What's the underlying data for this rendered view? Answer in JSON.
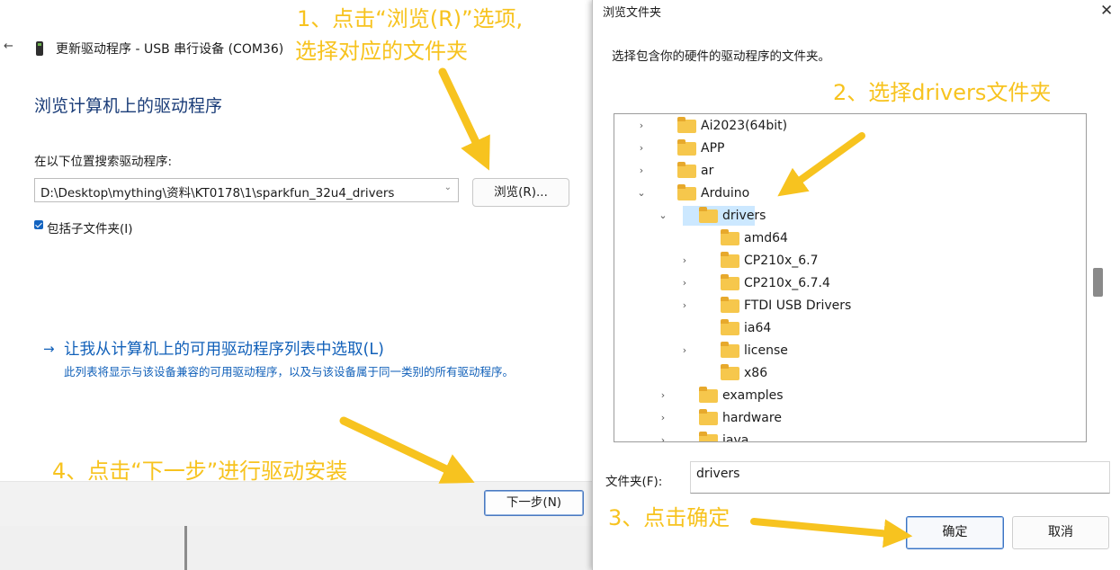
{
  "left_window": {
    "back_icon": "back-arrow-icon",
    "title": "更新驱动程序 - USB 串行设备 (COM36)",
    "heading": "浏览计算机上的驱动程序",
    "search_label": "在以下位置搜索驱动程序:",
    "path_value": "D:\\Desktop\\mything\\资料\\KT0178\\1\\sparkfun_32u4_drivers",
    "browse_label": "浏览(R)...",
    "include_subfolders_label": "包括子文件夹(I)",
    "include_subfolders_checked": true,
    "pick_link": "让我从计算机上的可用驱动程序列表中选取(L)",
    "pick_desc": "此列表将显示与该设备兼容的可用驱动程序，以及与该设备属于同一类别的所有驱动程序。",
    "next_label": "下一步(N)"
  },
  "dialog": {
    "title": "浏览文件夹",
    "close_icon": "close-icon",
    "instruction": "选择包含你的硬件的驱动程序的文件夹。",
    "tree": [
      {
        "label": "Ai2023(64bit)",
        "level": 0,
        "chevron": "›"
      },
      {
        "label": "APP",
        "level": 0,
        "chevron": "›"
      },
      {
        "label": "ar",
        "level": 0,
        "chevron": "›"
      },
      {
        "label": "Arduino",
        "level": 0,
        "chevron": "⌄"
      },
      {
        "label": "drivers",
        "level": 1,
        "chevron": "⌄",
        "selected": true
      },
      {
        "label": "amd64",
        "level": 2,
        "chevron": ""
      },
      {
        "label": "CP210x_6.7",
        "level": 2,
        "chevron": "›"
      },
      {
        "label": "CP210x_6.7.4",
        "level": 2,
        "chevron": "›"
      },
      {
        "label": "FTDI USB Drivers",
        "level": 2,
        "chevron": "›"
      },
      {
        "label": "ia64",
        "level": 2,
        "chevron": ""
      },
      {
        "label": "license",
        "level": 2,
        "chevron": "›"
      },
      {
        "label": "x86",
        "level": 2,
        "chevron": ""
      },
      {
        "label": "examples",
        "level": 1,
        "chevron": "›"
      },
      {
        "label": "hardware",
        "level": 1,
        "chevron": "›"
      },
      {
        "label": "java",
        "level": 1,
        "chevron": "›"
      }
    ],
    "folder_label": "文件夹(F):",
    "folder_value": "drivers",
    "ok_label": "确定",
    "cancel_label": "取消"
  },
  "annotations": {
    "step1_line1": "1、点击“浏览(R)”选项,",
    "step1_line2": "选择对应的文件夹",
    "step2": "2、选择drivers文件夹",
    "step3": "3、点击确定",
    "step4": "4、点击“下一步”进行驱动安装",
    "color": "#f7c31f"
  }
}
